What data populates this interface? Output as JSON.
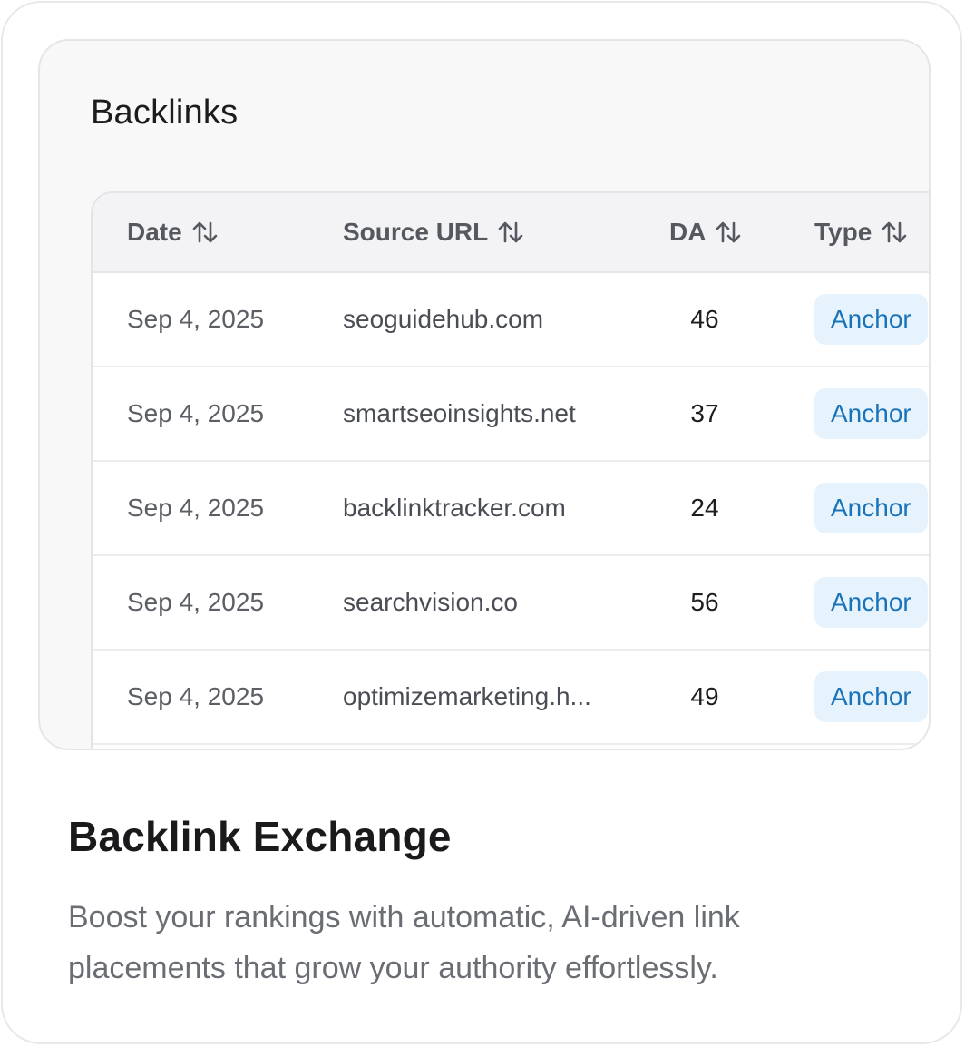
{
  "panel": {
    "title": "Backlinks"
  },
  "table": {
    "columns": [
      {
        "label": "Date"
      },
      {
        "label": "Source URL"
      },
      {
        "label": "DA"
      },
      {
        "label": "Type"
      }
    ],
    "rows": [
      {
        "date": "Sep 4, 2025",
        "url": "seoguidehub.com",
        "da": "46",
        "type": "Anchor"
      },
      {
        "date": "Sep 4, 2025",
        "url": "smartseoinsights.net",
        "da": "37",
        "type": "Anchor"
      },
      {
        "date": "Sep 4, 2025",
        "url": "backlinktracker.com",
        "da": "24",
        "type": "Anchor"
      },
      {
        "date": "Sep 4, 2025",
        "url": "searchvision.co",
        "da": "56",
        "type": "Anchor"
      },
      {
        "date": "Sep 4, 2025",
        "url": "optimizemarketing.h...",
        "da": "49",
        "type": "Anchor"
      }
    ]
  },
  "feature": {
    "title": "Backlink Exchange",
    "description": "Boost your rankings with automatic, AI-driven link placements that grow your authority effortlessly."
  },
  "colors": {
    "badge_bg": "#e6f3fd",
    "badge_text": "#1a73b8"
  },
  "icons": {
    "sort": "sort-arrows-icon"
  }
}
